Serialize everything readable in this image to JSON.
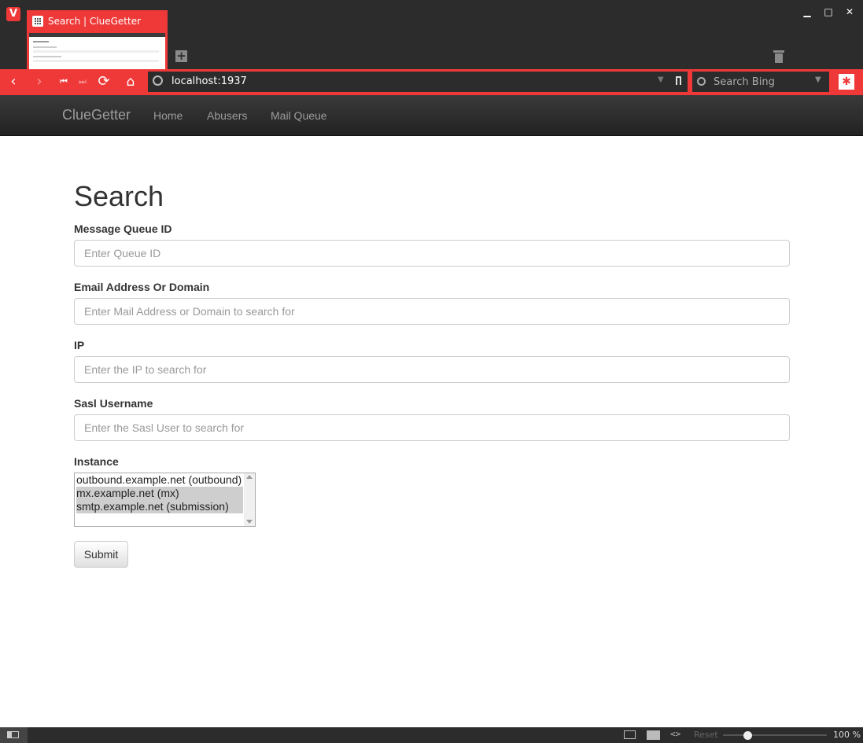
{
  "browser": {
    "tab_title": "Search | ClueGetter",
    "url": "localhost:1937",
    "search_placeholder": "Search Bing",
    "status": {
      "reset_label": "Reset",
      "zoom": "100 %",
      "zoom_fraction": 0.24
    }
  },
  "navbar": {
    "brand": "ClueGetter",
    "links": [
      "Home",
      "Abusers",
      "Mail Queue"
    ]
  },
  "page": {
    "title": "Search",
    "fields": [
      {
        "label": "Message Queue ID",
        "placeholder": "Enter Queue ID",
        "value": ""
      },
      {
        "label": "Email Address Or Domain",
        "placeholder": "Enter Mail Address or Domain to search for",
        "value": ""
      },
      {
        "label": "IP",
        "placeholder": "Enter the IP to search for",
        "value": ""
      },
      {
        "label": "Sasl Username",
        "placeholder": "Enter the Sasl User to search for",
        "value": ""
      }
    ],
    "instance": {
      "label": "Instance",
      "options": [
        {
          "text": "outbound.example.net (outbound)",
          "selected": false
        },
        {
          "text": "mx.example.net (mx)",
          "selected": true
        },
        {
          "text": "smtp.example.net (submission)",
          "selected": true
        }
      ]
    },
    "submit_label": "Submit"
  },
  "colors": {
    "browser_accent": "#ef3939",
    "chrome_dark": "#2c2c2c",
    "navbar_text": "#9d9d9d"
  }
}
